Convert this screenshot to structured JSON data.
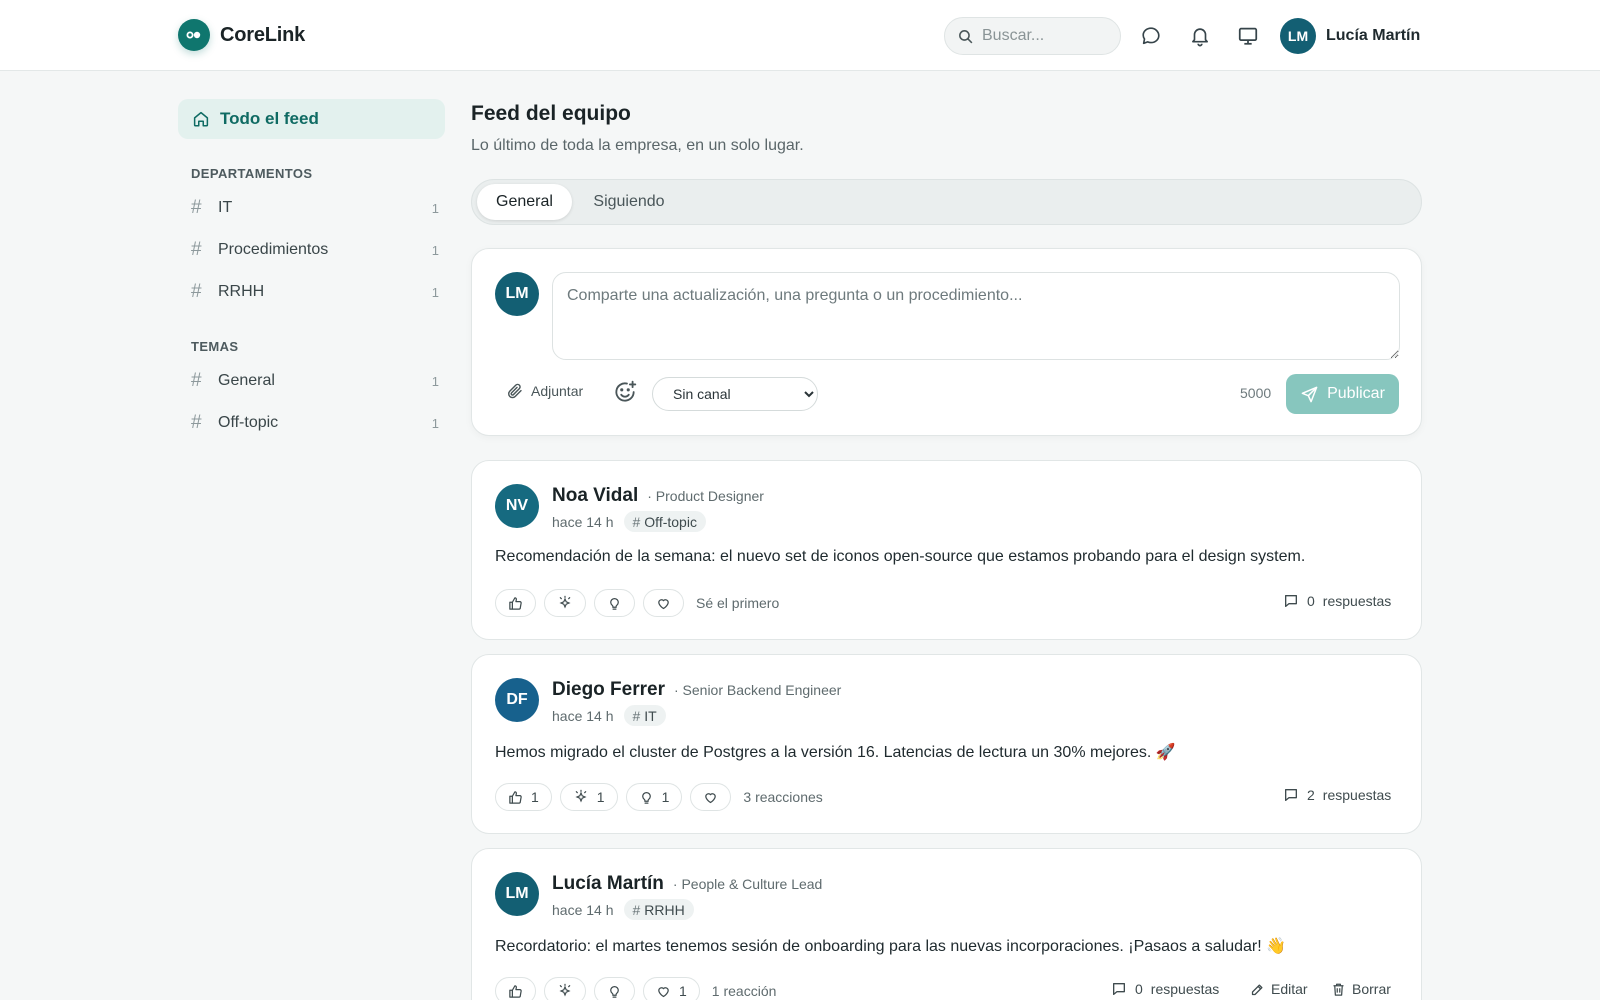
{
  "header": {
    "app_name": "CoreLink",
    "search_placeholder": "Buscar...",
    "user_initials": "LM",
    "user_name": "Lucía Martín"
  },
  "sidebar": {
    "all_feed_label": "Todo el feed",
    "departments_heading": "DEPARTAMENTOS",
    "departments": [
      {
        "label": "IT",
        "count": "1"
      },
      {
        "label": "Procedimientos",
        "count": "1"
      },
      {
        "label": "RRHH",
        "count": "1"
      }
    ],
    "topics_heading": "TEMAS",
    "topics": [
      {
        "label": "General",
        "count": "1"
      },
      {
        "label": "Off-topic",
        "count": "1"
      }
    ]
  },
  "main": {
    "title": "Feed del equipo",
    "subtitle": "Lo último de toda la empresa, en un solo lugar.",
    "tabs": [
      {
        "label": "General",
        "active": true
      },
      {
        "label": "Siguiendo",
        "active": false
      }
    ]
  },
  "composer": {
    "avatar_initials": "LM",
    "placeholder": "Comparte una actualización, una pregunta o un procedimiento...",
    "attach_label": "Adjuntar",
    "channel_selected": "Sin canal",
    "char_count": "5000",
    "publish_label": "Publicar"
  },
  "posts": [
    {
      "initials": "NV",
      "author": "Noa Vidal",
      "role": "· Product Designer",
      "time": "hace 14 h",
      "tag": "Off-topic",
      "body": "Recomendación de la semana: el nuevo set de iconos open-source que estamos probando para el design system.",
      "reaction_counts": [
        "",
        "",
        "",
        ""
      ],
      "reaction_summary": "Sé el primero",
      "reply_count": "0",
      "reply_label": "respuestas"
    },
    {
      "initials": "DF",
      "author": "Diego Ferrer",
      "role": "· Senior Backend Engineer",
      "time": "hace 14 h",
      "tag": "IT",
      "body": "Hemos migrado el cluster de Postgres a la versión 16. Latencias de lectura un 30% mejores.",
      "body_emoji": "🚀",
      "reaction_counts": [
        "1",
        "1",
        "1",
        ""
      ],
      "reaction_summary": "3 reacciones",
      "reply_count": "2",
      "reply_label": "respuestas"
    },
    {
      "initials": "LM",
      "author": "Lucía Martín",
      "role": "· People & Culture Lead",
      "time": "hace 14 h",
      "tag": "RRHH",
      "body": "Recordatorio: el martes tenemos sesión de onboarding para las nuevas incorporaciones. ¡Pasaos a saludar!",
      "body_emoji": "👋",
      "reaction_counts": [
        "",
        "",
        "",
        "1"
      ],
      "reaction_summary": "1 reacción",
      "reply_count": "0",
      "reply_label": "respuestas",
      "edit_label": "Editar",
      "delete_label": "Borrar"
    }
  ],
  "colors": {
    "accent": "#0f766e",
    "accent_soft": "#e3f1ee",
    "publish_disabled": "#87c6be",
    "background": "#f5f7f7"
  }
}
